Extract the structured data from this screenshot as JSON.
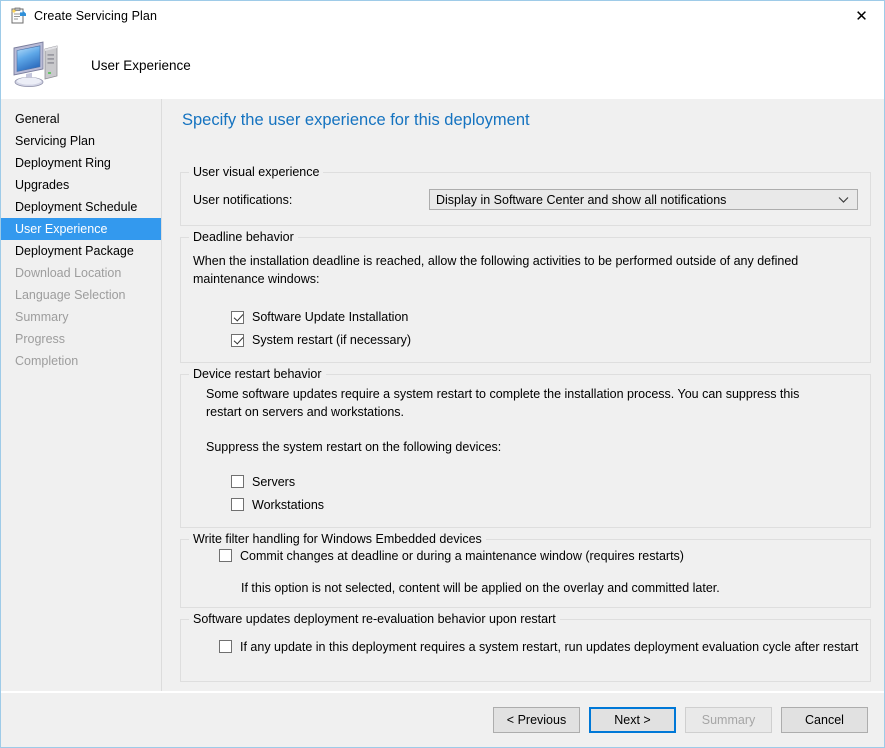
{
  "window": {
    "title": "Create Servicing Plan",
    "title_icon": "new-servicing-plan-icon",
    "close_label": "✕",
    "banner_title": "User Experience",
    "banner_icon": "computer-icon"
  },
  "sidebar": {
    "items": [
      {
        "label": "General",
        "state": "enabled"
      },
      {
        "label": "Servicing Plan",
        "state": "enabled"
      },
      {
        "label": "Deployment Ring",
        "state": "enabled"
      },
      {
        "label": "Upgrades",
        "state": "enabled"
      },
      {
        "label": "Deployment Schedule",
        "state": "enabled"
      },
      {
        "label": "User Experience",
        "state": "selected"
      },
      {
        "label": "Deployment Package",
        "state": "enabled"
      },
      {
        "label": "Download Location",
        "state": "disabled"
      },
      {
        "label": "Language Selection",
        "state": "disabled"
      },
      {
        "label": "Summary",
        "state": "disabled"
      },
      {
        "label": "Progress",
        "state": "disabled"
      },
      {
        "label": "Completion",
        "state": "disabled"
      }
    ]
  },
  "main": {
    "heading": "Specify the user experience for this deployment",
    "visual_experience": {
      "legend": "User visual experience",
      "notifications_label": "User notifications:",
      "notifications_value": "Display in Software Center and show all notifications",
      "dropdown_icon": "chevron-down-icon"
    },
    "deadline_behavior": {
      "legend": "Deadline behavior",
      "description": "When the installation deadline is reached, allow the following activities to be performed outside of any defined maintenance windows:",
      "checkbox_software_update": "Software Update Installation",
      "checkbox_software_update_checked": true,
      "checkbox_system_restart": "System restart (if necessary)",
      "checkbox_system_restart_checked": true
    },
    "device_restart_behavior": {
      "legend": "Device restart behavior",
      "description": "Some software updates require a system restart to complete the installation process. You can suppress this restart on servers and workstations.",
      "suppress_label": "Suppress the system restart on the following devices:",
      "checkbox_servers": "Servers",
      "checkbox_servers_checked": false,
      "checkbox_workstations": "Workstations",
      "checkbox_workstations_checked": false
    },
    "write_filter": {
      "legend": "Write filter handling for Windows Embedded devices",
      "checkbox_commit": "Commit changes at deadline or during a maintenance window (requires restarts)",
      "checkbox_commit_checked": false,
      "note": "If this option is not selected, content will be applied on the overlay and committed later."
    },
    "reevaluation": {
      "legend": "Software updates deployment re-evaluation behavior upon restart",
      "checkbox_reeval": "If any update in this deployment requires a system restart, run updates deployment evaluation cycle after restart",
      "checkbox_reeval_checked": false
    }
  },
  "footer": {
    "previous": "< Previous",
    "next": "Next >",
    "summary": "Summary",
    "cancel": "Cancel"
  },
  "colors": {
    "accent_blue": "#0078d7",
    "selection_blue": "#3399ee",
    "heading_blue": "#1573c0"
  }
}
